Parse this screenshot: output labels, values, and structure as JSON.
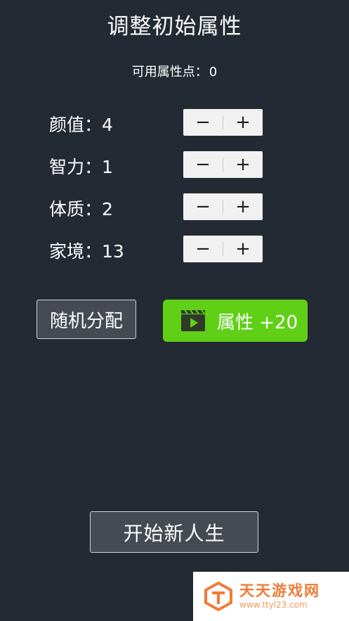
{
  "header": {
    "title": "调整初始属性",
    "points_label": "可用属性点：",
    "points_value": "0"
  },
  "attributes": [
    {
      "label": "颜值：",
      "value": "4"
    },
    {
      "label": "智力：",
      "value": "1"
    },
    {
      "label": "体质：",
      "value": "2"
    },
    {
      "label": "家境：",
      "value": "13"
    }
  ],
  "stepper": {
    "minus_symbol": "−",
    "plus_symbol": "+"
  },
  "actions": {
    "random_label": "随机分配",
    "ad_label": "属性 +20",
    "ad_icon": "video-play-icon",
    "ad_color": "#5fd016"
  },
  "footer": {
    "start_label": "开始新人生"
  },
  "watermark": {
    "name": "天天游戏网",
    "url": "www.ttyl23.com"
  },
  "colors": {
    "background": "#242a33",
    "button_bg": "#464b53",
    "stepper_bg": "#f1f1f1",
    "watermark_orange": "#f27a36"
  }
}
